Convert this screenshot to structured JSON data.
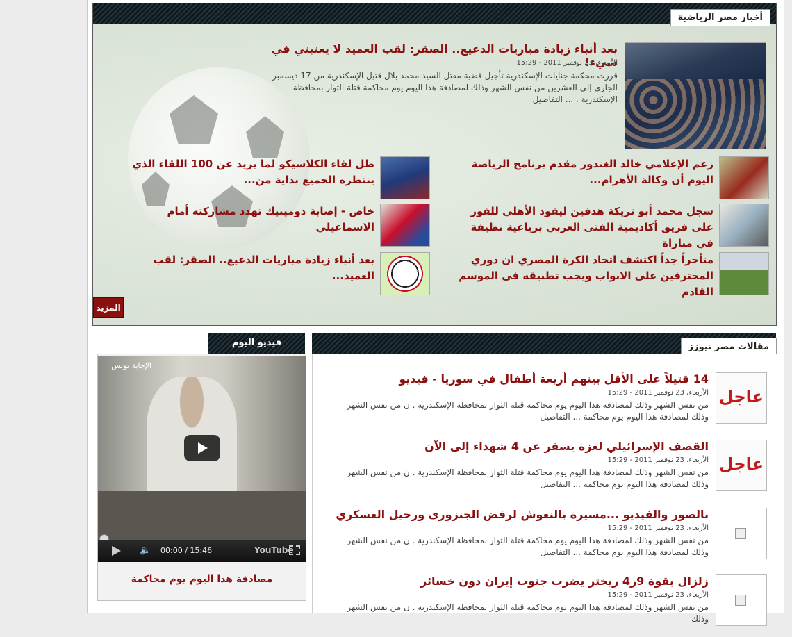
{
  "sports": {
    "header": "أخبار مصر الرياضية",
    "main": {
      "title": "بعد أنباء زيادة مباريات الدعيع.. الصقر: لقب العميد لا يعنيني في شيء!",
      "date": "الأربعاء، 23 نوفمبر 2011 - 15:29",
      "text": "قررت محكمة جنايات الإسكندرية تأجيل قضية مقتل السيد محمد بلال قتيل الإسكندرية من 17 ديسمبر الجارى إلي العشرين من نفس الشهر وذلك لمصادفة هذا اليوم يوم محاكمة قتلة الثوار بمحافظة الإسكندرية . ... التفاصيل"
    },
    "items": [
      {
        "title": "زعم الإعلامي خالد الغندور مقدم برنامج الرياضة اليوم أن وكالة الأهرام..."
      },
      {
        "title": "ظل لقاء الكلاسيكو لما يزيد عن 100 اللقاء الذي ينتظره الجميع بداية من..."
      },
      {
        "title": "سجل محمد أبو تريكة هدفين ليقود الأهلي للفوز على فريق أكاديمية الفتى العربي برباعية نظيفة في مباراة"
      },
      {
        "title": "خاص - إصابة دومينيك تهدد مشاركته أمام الاسماعيلي"
      },
      {
        "title": "متأخراً جداً اكتشف اتحاد الكرة المصري ان دوري المحترفين على الابواب ويجب تطبيقه فى الموسم القادم"
      },
      {
        "title": "بعد أنباء زيادة مباريات الدعيع.. الصقر: لقب العميد..."
      }
    ],
    "more_label": "المزيد"
  },
  "video": {
    "header": "فيديو اليوم",
    "player_title": "الإجابة تونس",
    "time": "00:00 / 15:46",
    "youtube_label": "YouTube",
    "caption": "مصادفة هذا اليوم يوم محاكمة"
  },
  "articles": {
    "header": "مقالات مصر نيوزز",
    "ajel_label": "عاجل",
    "items": [
      {
        "title": "14 قتيلاً على الأقل بينهم أربعة أطفال في سوريا - فيديو",
        "date": "الأربعاء، 23 نوفمبر 2011 - 15:29",
        "text": "من نفس الشهر وذلك لمصادفة هذا اليوم يوم محاكمة قتلة الثوار بمحافظة الإسكندرية . ن من نفس الشهر وذلك لمصادفة هذا اليوم يوم محاكمة ... التفاصيل"
      },
      {
        "title": "القصف الإسرائيلي لغزة يسفر عن 4 شهداء إلى الآن",
        "date": "الأربعاء، 23 نوفمبر 2011 - 15:29",
        "text": "من نفس الشهر وذلك لمصادفة هذا اليوم يوم محاكمة قتلة الثوار بمحافظة الإسكندرية . ن من نفس الشهر وذلك لمصادفة هذا اليوم يوم محاكمة ... التفاصيل"
      },
      {
        "title": "بالصور والفيديو ...مسيرة بالنعوش لرفض الجنزورى ورحيل العسكري",
        "date": "الأربعاء، 23 نوفمبر 2011 - 15:29",
        "text": "من نفس الشهر وذلك لمصادفة هذا اليوم يوم محاكمة قتلة الثوار بمحافظة الإسكندرية . ن من نفس الشهر وذلك لمصادفة هذا اليوم يوم محاكمة ... التفاصيل"
      },
      {
        "title": "زلزال بقوة 9ر4 ريختر يضرب جنوب إيران دون خسائر",
        "date": "الأربعاء، 23 نوفمبر 2011 - 15:29",
        "text": "من نفس الشهر وذلك لمصادفة هذا اليوم يوم محاكمة قتلة الثوار بمحافظة الإسكندرية . ن من نفس الشهر وذلك"
      }
    ]
  }
}
